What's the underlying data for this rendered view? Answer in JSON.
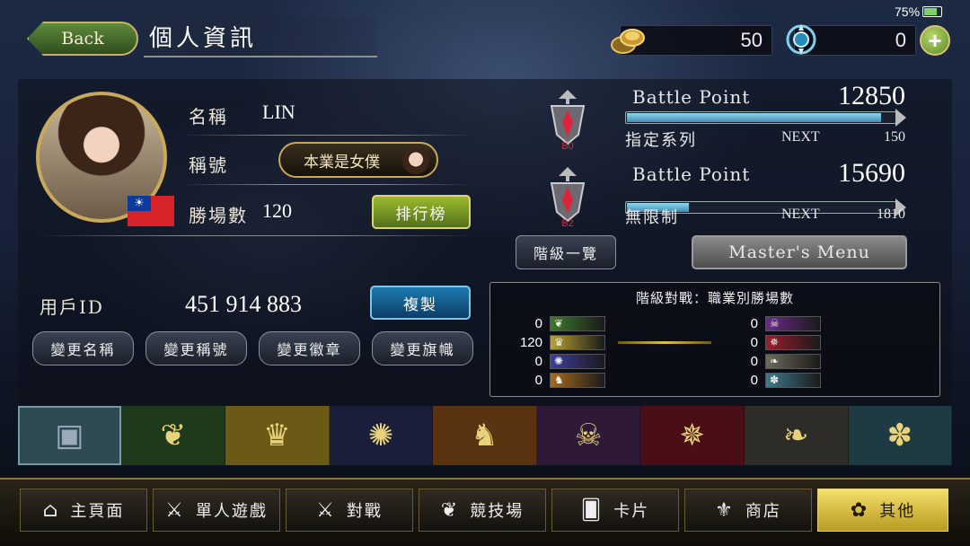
{
  "header": {
    "back_label": "Back",
    "title": "個人資訊",
    "battery": "75%",
    "battery_level": 0.75
  },
  "currency": {
    "coins": "50",
    "crystals": "0",
    "plus": "+"
  },
  "profile": {
    "name_label": "名稱",
    "name_value": "LIN",
    "title_label": "稱號",
    "title_value": "本業是女僕",
    "wins_label": "勝場數",
    "wins_value": "120",
    "ranking_button": "排行榜",
    "flag_symbol": "☀",
    "user_id_label": "用戶ID",
    "user_id_value": "451 914 883",
    "copy_button": "複製",
    "change_name": "變更名稱",
    "change_title": "變更稱號",
    "change_emblem": "變更徽章",
    "change_banner": "變更旗幟"
  },
  "rank": {
    "rows": [
      {
        "emblem": "B0",
        "label": "Battle Point",
        "value": "12850",
        "sub_label": "指定系列",
        "next_label": "NEXT",
        "next_value": "150",
        "progress": 0.95
      },
      {
        "emblem": "B2",
        "label": "Battle Point",
        "value": "15690",
        "sub_label": "無限制",
        "next_label": "NEXT",
        "next_value": "1810",
        "progress": 0.23
      }
    ],
    "rank_list_button": "階級一覽",
    "masters_menu_button": "Master's Menu"
  },
  "class_wins": {
    "title": "階級對戰：職業別勝場數",
    "left": [
      {
        "value": "0",
        "icon": "leaf-icon",
        "color": "#3d7a2a"
      },
      {
        "value": "120",
        "icon": "crown-icon",
        "color": "#b9a22e"
      },
      {
        "value": "0",
        "icon": "star-icon",
        "color": "#3e3e9e"
      },
      {
        "value": "0",
        "icon": "dragon-icon",
        "color": "#a86a1e"
      }
    ],
    "right": [
      {
        "value": "0",
        "icon": "skull-icon",
        "color": "#6a2a8a"
      },
      {
        "value": "0",
        "icon": "bat-icon",
        "color": "#9a1e2e"
      },
      {
        "value": "0",
        "icon": "wings-icon",
        "color": "#6e6a5a"
      },
      {
        "value": "0",
        "icon": "spiral-icon",
        "color": "#3e7a8a"
      }
    ]
  },
  "class_tabs": [
    {
      "icon": "card-back-icon",
      "glyph": "▣",
      "color": "#2e4a52"
    },
    {
      "icon": "leaf-icon",
      "glyph": "❦",
      "color": "#1e3a1a"
    },
    {
      "icon": "crown-icon",
      "glyph": "♛",
      "color": "#6a5a16"
    },
    {
      "icon": "star-icon",
      "glyph": "✺",
      "color": "#1a1e3a"
    },
    {
      "icon": "dragon-icon",
      "glyph": "♞",
      "color": "#5a3410"
    },
    {
      "icon": "skull-icon",
      "glyph": "☠",
      "color": "#2e1a36"
    },
    {
      "icon": "bat-icon",
      "glyph": "✵",
      "color": "#4a0e16"
    },
    {
      "icon": "wings-icon",
      "glyph": "❧",
      "color": "#2e2c28"
    },
    {
      "icon": "spiral-icon",
      "glyph": "✽",
      "color": "#1e3a42"
    }
  ],
  "nav": {
    "home": "主頁面",
    "solo": "單人遊戲",
    "battle": "對戰",
    "arena": "競技場",
    "cards": "卡片",
    "shop": "商店",
    "other": "其他"
  }
}
